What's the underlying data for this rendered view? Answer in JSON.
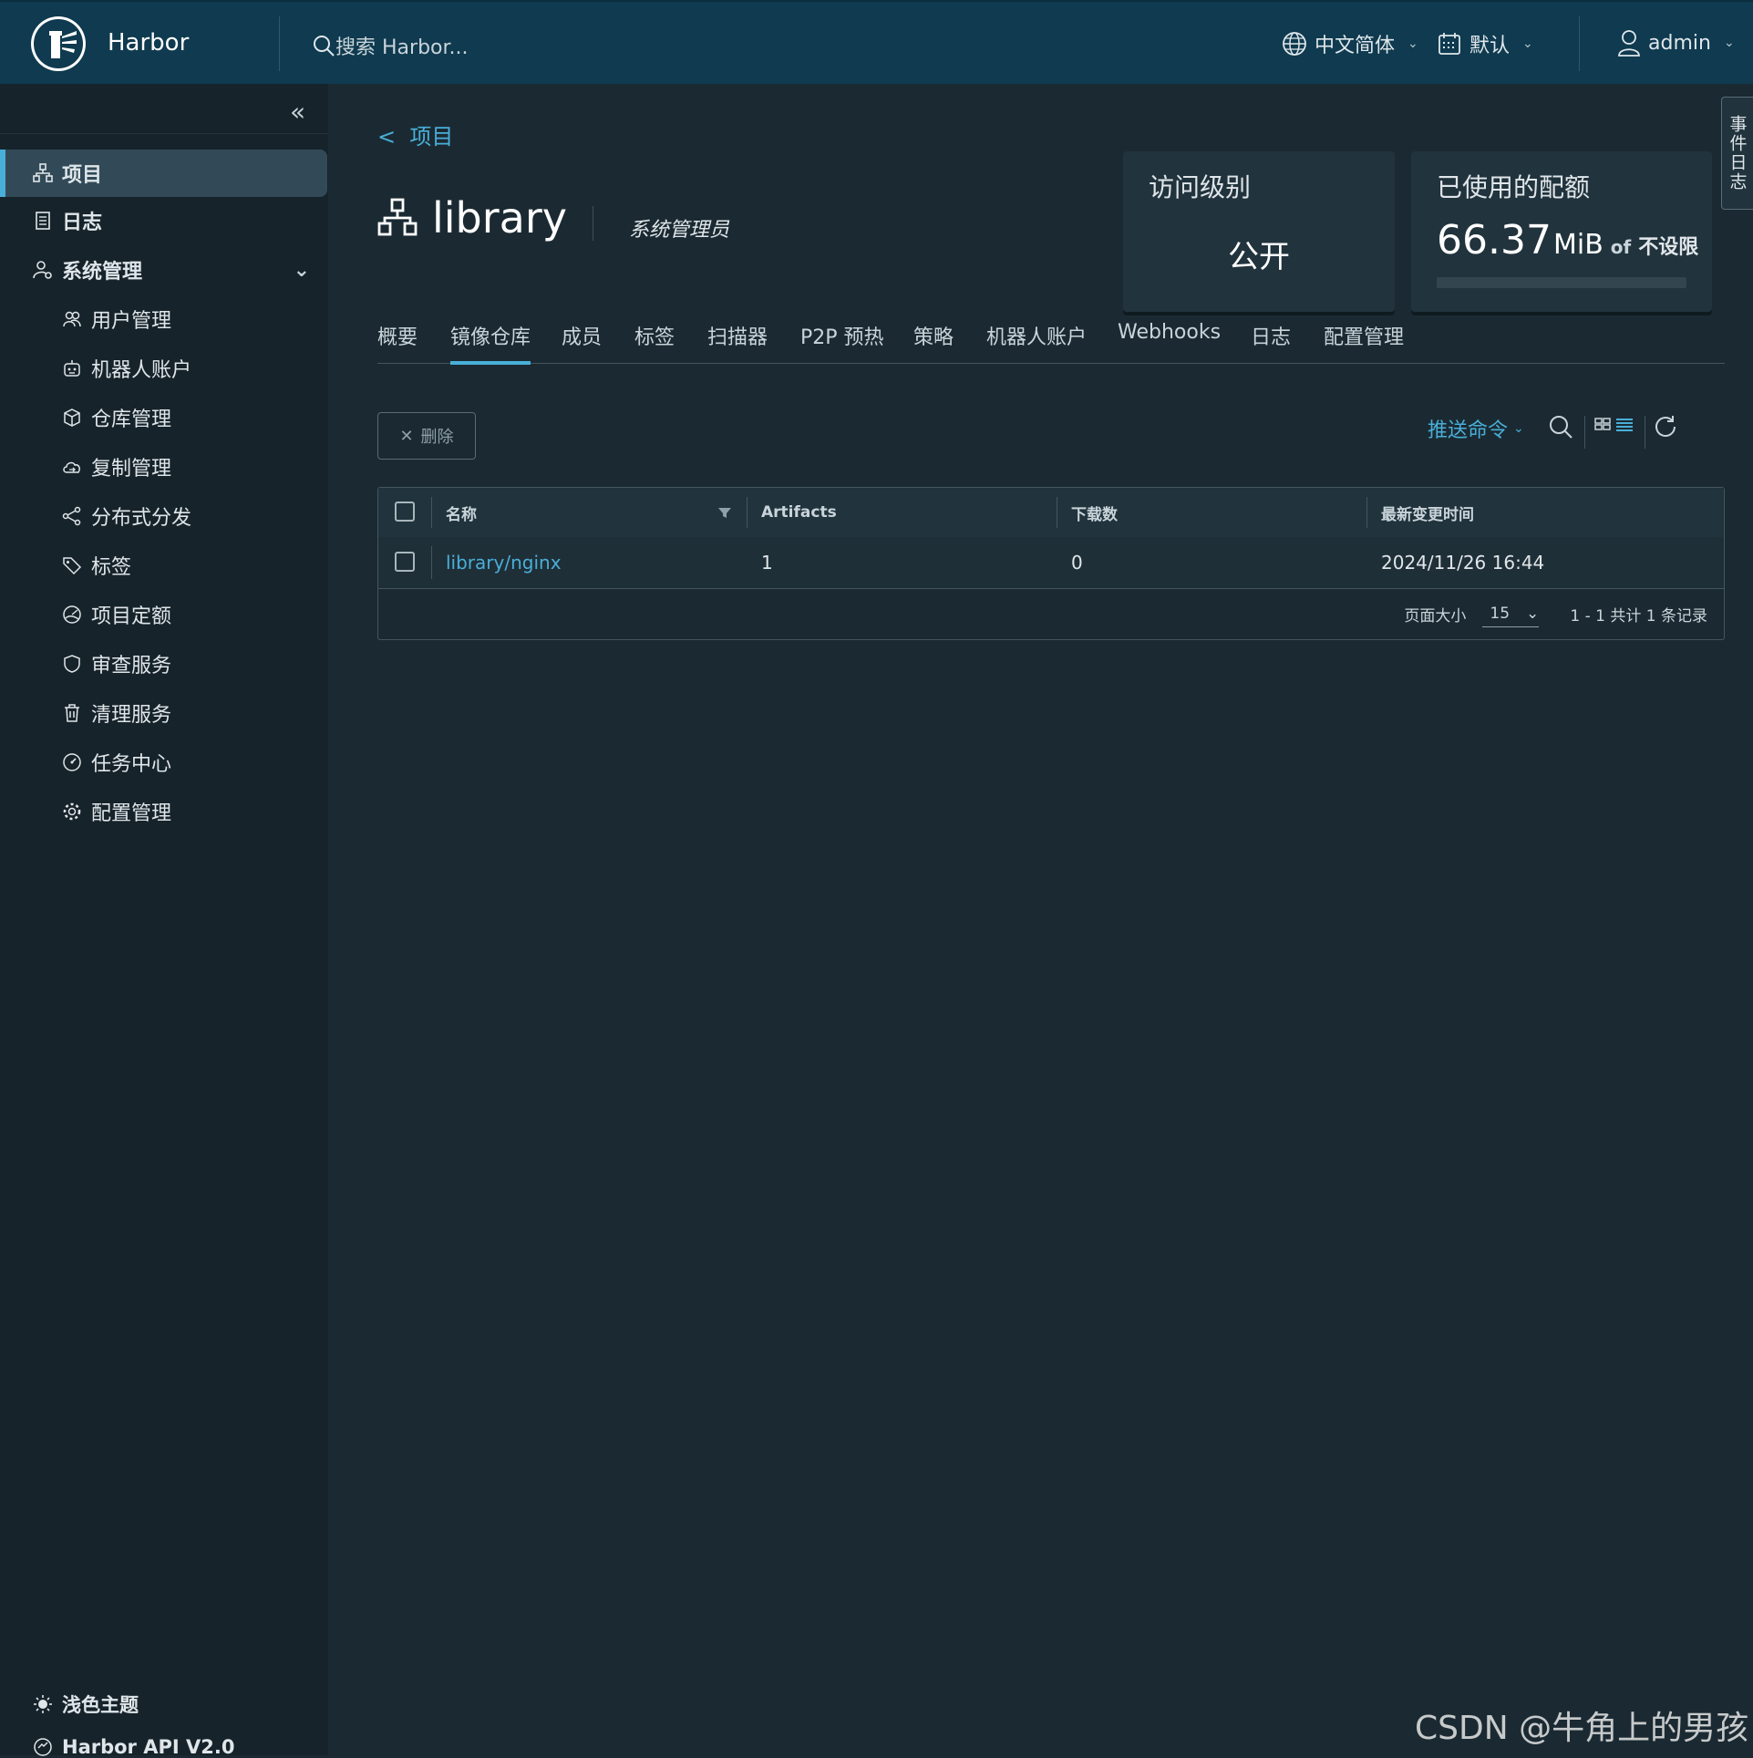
{
  "header": {
    "brand": "Harbor",
    "search_placeholder": "搜索 Harbor...",
    "language": "中文简体",
    "datetime_format": "默认",
    "user": "admin"
  },
  "sidebar": {
    "items": [
      {
        "label": "项目",
        "icon": "projects-icon",
        "active": true
      },
      {
        "label": "日志",
        "icon": "logs-icon"
      },
      {
        "label": "系统管理",
        "icon": "admin-icon",
        "expanded": true
      }
    ],
    "sub_items": [
      {
        "label": "用户管理",
        "icon": "users-icon"
      },
      {
        "label": "机器人账户",
        "icon": "robot-icon"
      },
      {
        "label": "仓库管理",
        "icon": "registry-icon"
      },
      {
        "label": "复制管理",
        "icon": "cloud-replication-icon"
      },
      {
        "label": "分布式分发",
        "icon": "share-icon"
      },
      {
        "label": "标签",
        "icon": "tag-icon"
      },
      {
        "label": "项目定额",
        "icon": "quota-icon"
      },
      {
        "label": "审查服务",
        "icon": "shield-icon"
      },
      {
        "label": "清理服务",
        "icon": "trash-icon"
      },
      {
        "label": "任务中心",
        "icon": "dashboard-icon"
      },
      {
        "label": "配置管理",
        "icon": "gear-icon"
      }
    ],
    "theme_toggle": "浅色主题",
    "api_link": "Harbor API V2.0"
  },
  "page": {
    "back_link": "项目",
    "title": "library",
    "role": "系统管理员",
    "access_card": {
      "title": "访问级别",
      "value": "公开"
    },
    "quota_card": {
      "title": "已使用的配额",
      "used": "66.37",
      "unit": "MiB",
      "of": "of",
      "limit": "不设限",
      "fraction": 0
    }
  },
  "tabs": [
    "概要",
    "镜像仓库",
    "成员",
    "标签",
    "扫描器",
    "P2P 预热",
    "策略",
    "机器人账户",
    "Webhooks",
    "日志",
    "配置管理"
  ],
  "active_tab": "镜像仓库",
  "toolbar": {
    "delete_label": "删除",
    "push_command_label": "推送命令"
  },
  "table": {
    "columns": [
      "名称",
      "Artifacts",
      "下载数",
      "最新变更时间"
    ],
    "rows": [
      {
        "name": "library/nginx",
        "artifacts": "1",
        "pulls": "0",
        "updated": "2024/11/26 16:44"
      }
    ],
    "page_size_label": "页面大小",
    "page_size": "15",
    "summary": "1 - 1 共计 1 条记录"
  },
  "event_log_tab": "事件日志",
  "watermark": "CSDN @牛角上的男孩",
  "colors": {
    "header": "#0f3a4f",
    "sidebar": "#17232a",
    "content": "#1b2a32",
    "accent": "#49afd9"
  }
}
